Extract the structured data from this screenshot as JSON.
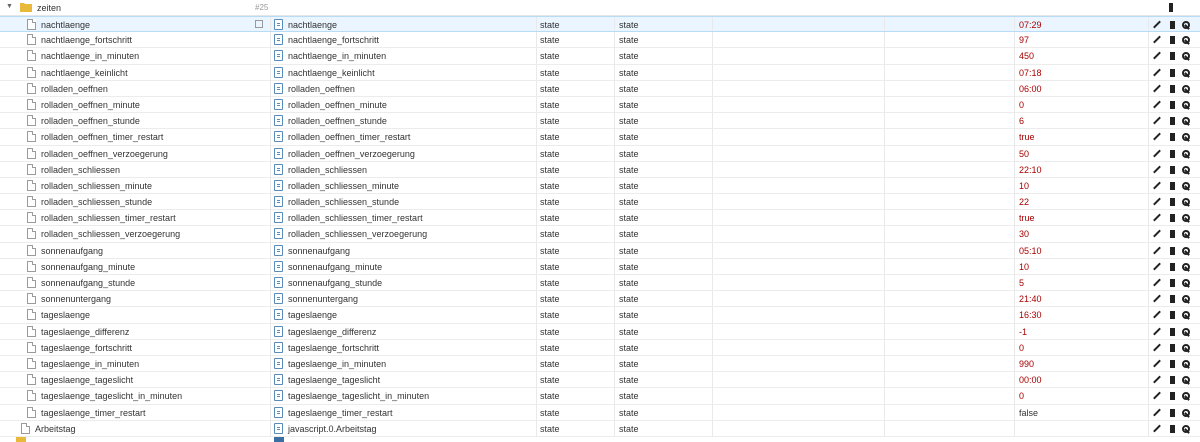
{
  "folder": {
    "name": "zeiten",
    "count": "#25"
  },
  "rows": [
    {
      "id": "nachtlaenge",
      "name": "nachtlaenge",
      "type": "state",
      "role": "state",
      "value": "07:29",
      "selected": true
    },
    {
      "id": "nachtlaenge_fortschritt",
      "name": "nachtlaenge_fortschritt",
      "type": "state",
      "role": "state",
      "value": "97"
    },
    {
      "id": "nachtlaenge_in_minuten",
      "name": "nachtlaenge_in_minuten",
      "type": "state",
      "role": "state",
      "value": "450"
    },
    {
      "id": "nachtlaenge_keinlicht",
      "name": "nachtlaenge_keinlicht",
      "type": "state",
      "role": "state",
      "value": "07:18"
    },
    {
      "id": "rolladen_oeffnen",
      "name": "rolladen_oeffnen",
      "type": "state",
      "role": "state",
      "value": "06:00"
    },
    {
      "id": "rolladen_oeffnen_minute",
      "name": "rolladen_oeffnen_minute",
      "type": "state",
      "role": "state",
      "value": "0"
    },
    {
      "id": "rolladen_oeffnen_stunde",
      "name": "rolladen_oeffnen_stunde",
      "type": "state",
      "role": "state",
      "value": "6"
    },
    {
      "id": "rolladen_oeffnen_timer_restart",
      "name": "rolladen_oeffnen_timer_restart",
      "type": "state",
      "role": "state",
      "value": "true"
    },
    {
      "id": "rolladen_oeffnen_verzoegerung",
      "name": "rolladen_oeffnen_verzoegerung",
      "type": "state",
      "role": "state",
      "value": "50"
    },
    {
      "id": "rolladen_schliessen",
      "name": "rolladen_schliessen",
      "type": "state",
      "role": "state",
      "value": "22:10"
    },
    {
      "id": "rolladen_schliessen_minute",
      "name": "rolladen_schliessen_minute",
      "type": "state",
      "role": "state",
      "value": "10"
    },
    {
      "id": "rolladen_schliessen_stunde",
      "name": "rolladen_schliessen_stunde",
      "type": "state",
      "role": "state",
      "value": "22"
    },
    {
      "id": "rolladen_schliessen_timer_restart",
      "name": "rolladen_schliessen_timer_restart",
      "type": "state",
      "role": "state",
      "value": "true"
    },
    {
      "id": "rolladen_schliessen_verzoegerung",
      "name": "rolladen_schliessen_verzoegerung",
      "type": "state",
      "role": "state",
      "value": "30"
    },
    {
      "id": "sonnenaufgang",
      "name": "sonnenaufgang",
      "type": "state",
      "role": "state",
      "value": "05:10"
    },
    {
      "id": "sonnenaufgang_minute",
      "name": "sonnenaufgang_minute",
      "type": "state",
      "role": "state",
      "value": "10"
    },
    {
      "id": "sonnenaufgang_stunde",
      "name": "sonnenaufgang_stunde",
      "type": "state",
      "role": "state",
      "value": "5"
    },
    {
      "id": "sonnenuntergang",
      "name": "sonnenuntergang",
      "type": "state",
      "role": "state",
      "value": "21:40"
    },
    {
      "id": "tageslaenge",
      "name": "tageslaenge",
      "type": "state",
      "role": "state",
      "value": "16:30"
    },
    {
      "id": "tageslaenge_differenz",
      "name": "tageslaenge_differenz",
      "type": "state",
      "role": "state",
      "value": "-1"
    },
    {
      "id": "tageslaenge_fortschritt",
      "name": "tageslaenge_fortschritt",
      "type": "state",
      "role": "state",
      "value": "0"
    },
    {
      "id": "tageslaenge_in_minuten",
      "name": "tageslaenge_in_minuten",
      "type": "state",
      "role": "state",
      "value": "990"
    },
    {
      "id": "tageslaenge_tageslicht",
      "name": "tageslaenge_tageslicht",
      "type": "state",
      "role": "state",
      "value": "00:00"
    },
    {
      "id": "tageslaenge_tageslicht_in_minuten",
      "name": "tageslaenge_tageslicht_in_minuten",
      "type": "state",
      "role": "state",
      "value": "0"
    },
    {
      "id": "tageslaenge_timer_restart",
      "name": "tageslaenge_timer_restart",
      "type": "state",
      "role": "state",
      "value": "false",
      "plain": true
    },
    {
      "id": "Arbeitstag",
      "name": "javascript.0.Arbeitstag",
      "type": "state",
      "role": "state",
      "value": "",
      "indent": "outer"
    }
  ]
}
